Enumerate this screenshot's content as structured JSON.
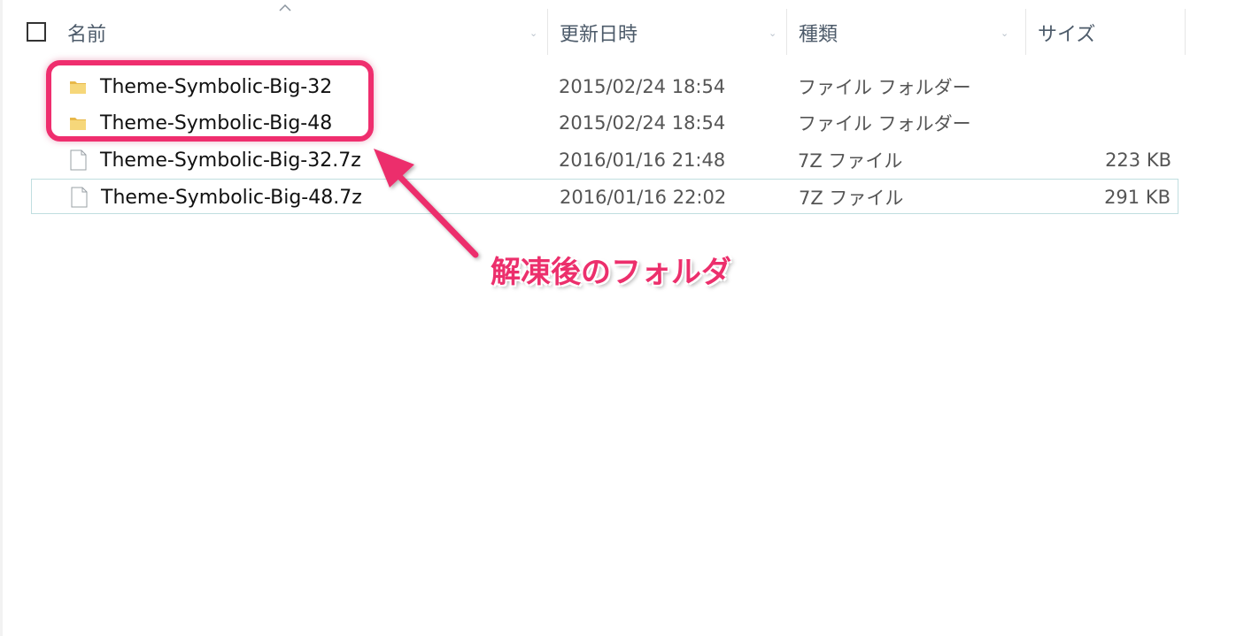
{
  "header": {
    "name_label": "名前",
    "modified_label": "更新日時",
    "type_label": "種類",
    "size_label": "サイズ"
  },
  "files": [
    {
      "name": "Theme-Symbolic-Big-32",
      "modified": "2015/02/24 18:54",
      "type": "ファイル フォルダー",
      "size": "",
      "icon": "folder-icon"
    },
    {
      "name": "Theme-Symbolic-Big-48",
      "modified": "2015/02/24 18:54",
      "type": "ファイル フォルダー",
      "size": "",
      "icon": "folder-icon"
    },
    {
      "name": "Theme-Symbolic-Big-32.7z",
      "modified": "2016/01/16 21:48",
      "type": "7Z ファイル",
      "size": "223 KB",
      "icon": "file-icon"
    },
    {
      "name": "Theme-Symbolic-Big-48.7z",
      "modified": "2016/01/16 22:02",
      "type": "7Z ファイル",
      "size": "291 KB",
      "icon": "file-icon"
    }
  ],
  "annotation": {
    "text": "解凍後のフォルダ",
    "color": "#ec2f6c"
  },
  "colors": {
    "folder": "#f3cc6a",
    "focus_border": "#c0dee0",
    "header_text": "#4d5b6a"
  }
}
